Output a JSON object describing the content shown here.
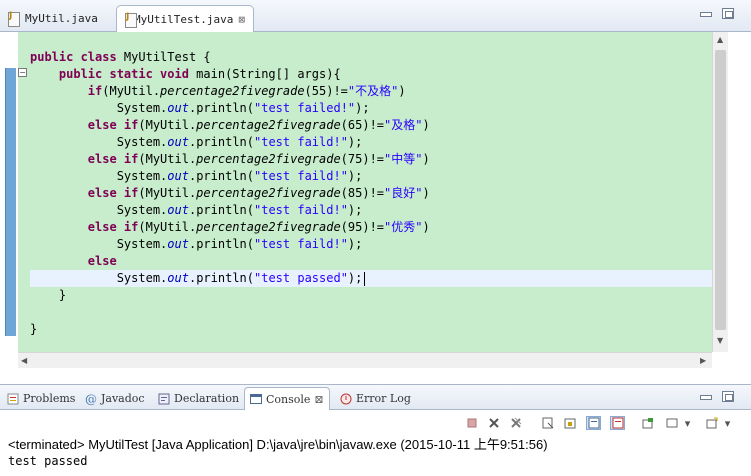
{
  "editor_tabs": [
    {
      "label": "MyUtil.java",
      "active": false
    },
    {
      "label": "MyUtilTest.java",
      "active": true,
      "close": "⊠"
    }
  ],
  "code": {
    "l1_kw": "public class",
    "l1_rest": " MyUtilTest {",
    "l2_kw": "public static void",
    "l2_rest": " main(String[] args){",
    "l3_kw": "if",
    "l3_a": "(MyUtil.",
    "l3_method": "percentage2fivegrade",
    "l3_b": "(55)!=",
    "l3_str": "\"不及格\"",
    "l3_c": ")",
    "l4_a": "System.",
    "l4_out": "out",
    "l4_b": ".println(",
    "l4_str": "\"test failed!\"",
    "l4_c": ");",
    "l5_kw": "else if",
    "l5_a": "(MyUtil.",
    "l5_method": "percentage2fivegrade",
    "l5_b": "(65)!=",
    "l5_str": "\"及格\"",
    "l5_c": ")",
    "l6_a": "System.",
    "l6_out": "out",
    "l6_b": ".println(",
    "l6_str": "\"test faild!\"",
    "l6_c": ");",
    "l7_kw": "else if",
    "l7_a": "(MyUtil.",
    "l7_method": "percentage2fivegrade",
    "l7_b": "(75)!=",
    "l7_str": "\"中等\"",
    "l7_c": ")",
    "l8_a": "System.",
    "l8_out": "out",
    "l8_b": ".println(",
    "l8_str": "\"test faild!\"",
    "l8_c": ");",
    "l9_kw": "else if",
    "l9_a": "(MyUtil.",
    "l9_method": "percentage2fivegrade",
    "l9_b": "(85)!=",
    "l9_str": "\"良好\"",
    "l9_c": ")",
    "l10_a": "System.",
    "l10_out": "out",
    "l10_b": ".println(",
    "l10_str": "\"test faild!\"",
    "l10_c": ");",
    "l11_kw": "else if",
    "l11_a": "(MyUtil.",
    "l11_method": "percentage2fivegrade",
    "l11_b": "(95)!=",
    "l11_str": "\"优秀\"",
    "l11_c": ")",
    "l12_a": "System.",
    "l12_out": "out",
    "l12_b": ".println(",
    "l12_str": "\"test faild!\"",
    "l12_c": ");",
    "l13_kw": "else",
    "l14_a": "System.",
    "l14_out": "out",
    "l14_b": ".println(",
    "l14_str": "\"test passed\"",
    "l14_c": ");",
    "l15": "}",
    "l17": "}",
    "fold_marker": "−"
  },
  "views": [
    {
      "label": "Problems",
      "icon": "problems-icon"
    },
    {
      "label": "Javadoc",
      "icon": "at-icon"
    },
    {
      "label": "Declaration",
      "icon": "declaration-icon"
    },
    {
      "label": "Console",
      "icon": "console-icon",
      "active": true,
      "close": "⊠"
    },
    {
      "label": "Error Log",
      "icon": "error-log-icon"
    }
  ],
  "console": {
    "header": "<terminated> MyUtilTest [Java Application] D:\\java\\jre\\bin\\javaw.exe (2015-10-11 上午9:51:56)",
    "output": "test passed"
  },
  "colors": {
    "editor_bg": "#c7edcc",
    "keyword": "#7f0055",
    "string": "#2a00ff",
    "static_field": "#0000c0",
    "ruler": "#6fa6d6"
  }
}
